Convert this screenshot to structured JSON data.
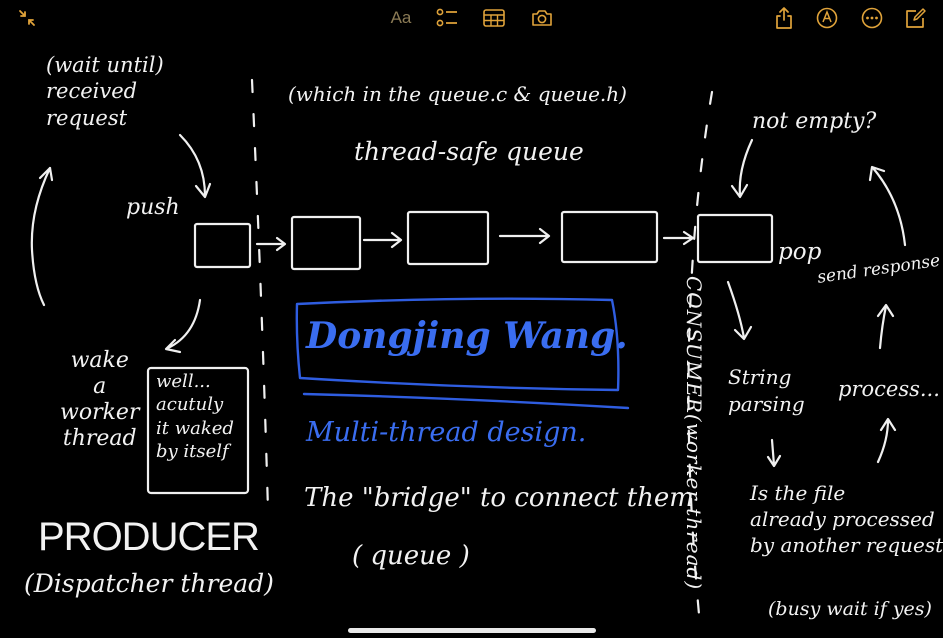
{
  "toolbar": {
    "left_icons": [
      "collapse-icon"
    ],
    "center": {
      "format_label": "Aa",
      "icons": [
        "checklist-icon",
        "table-icon",
        "camera-icon"
      ]
    },
    "right_icons": [
      "share-icon",
      "markup-icon",
      "more-icon",
      "compose-icon"
    ],
    "accent": "#e0a33a"
  },
  "note": {
    "producer_wait": "(wait until)\nreceived\nrequest",
    "push": "push",
    "wake": "wake\na\nworker\nthread",
    "well": "well...\nacutuly\nit waked\nby itself",
    "producer_title": "PRODUCER",
    "producer_sub": "(Dispatcher thread)",
    "queue_files": "(which in the queue.c & queue.h)",
    "queue_title": "thread-safe queue",
    "signature": "Dongjing Wang.",
    "multi": "Multi-thread design.",
    "bridge": "The \"bridge\" to connect them",
    "queue_paren": "( queue )",
    "not_empty": "not empty?",
    "pop": "pop",
    "send_response": "send response",
    "consumer_label": "CONSUMER(worker thread)",
    "string_parsing": "String\nparsing",
    "process": "process...",
    "is_file": "Is the file\nalready processed\nby another request",
    "busy_wait": "(busy wait if yes)",
    "ink_color": "#f0f0f0",
    "blue_color": "#2f5de0"
  }
}
